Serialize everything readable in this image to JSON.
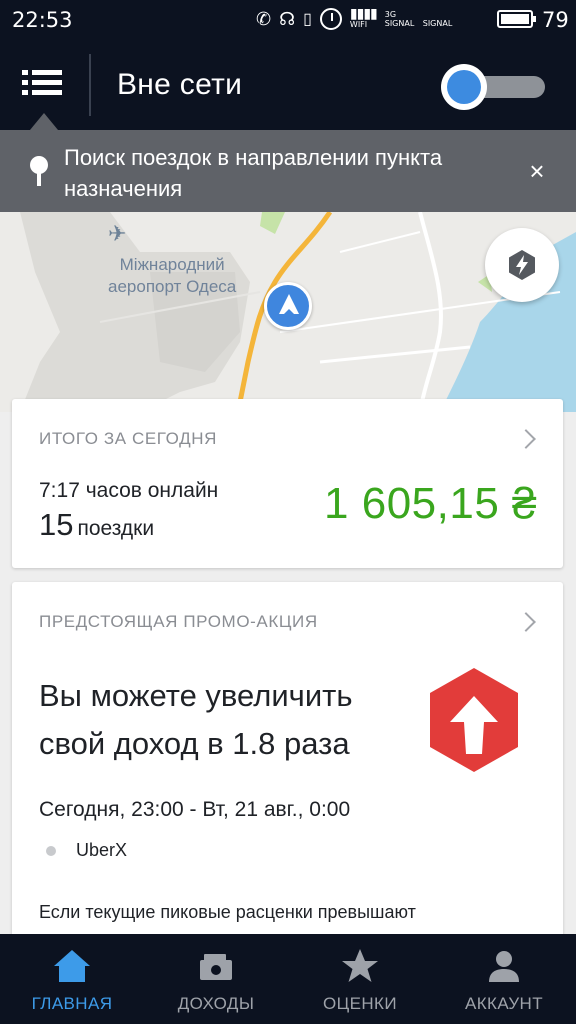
{
  "status_bar": {
    "time": "22:53",
    "signal_1": "3G SIGNAL",
    "signal_2": "SIGNAL",
    "battery": "79",
    "wifi_label": "WIFI"
  },
  "app_bar": {
    "title": "Вне сети",
    "online_toggle": {
      "state": "off",
      "accent": "#3d8be0"
    }
  },
  "banner": {
    "text": "Поиск поездок в направлении пункта назначения",
    "close": "×"
  },
  "map": {
    "place_label_line1": "Міжнародний",
    "place_label_line2": "аеропорт Одеса"
  },
  "today_card": {
    "header": "ИТОГО ЗА СЕГОДНЯ",
    "hours_online": "7:17 часов онлайн",
    "trips_count": "15",
    "trips_label": "поездки",
    "amount": "1 605,15 ₴",
    "amount_color": "#3aa61e"
  },
  "promo_card": {
    "header": "ПРЕДСТОЯЩАЯ ПРОМО-АКЦИЯ",
    "title": "Вы можете увеличить свой доход в 1.8 раза",
    "date_range": "Сегодня, 23:00 - Вт, 21 авг., 0:00",
    "product": "UberX",
    "description": "Если текущие пиковые расценки превышают"
  },
  "bottom_nav": {
    "items": [
      {
        "label": "ГЛАВНАЯ",
        "icon": "home-icon",
        "active": true
      },
      {
        "label": "ДОХОДЫ",
        "icon": "wallet-icon",
        "active": false
      },
      {
        "label": "ОЦЕНКИ",
        "icon": "star-icon",
        "active": false
      },
      {
        "label": "АККАУНТ",
        "icon": "person-icon",
        "active": false
      }
    ],
    "active_color": "#3d9be9"
  }
}
